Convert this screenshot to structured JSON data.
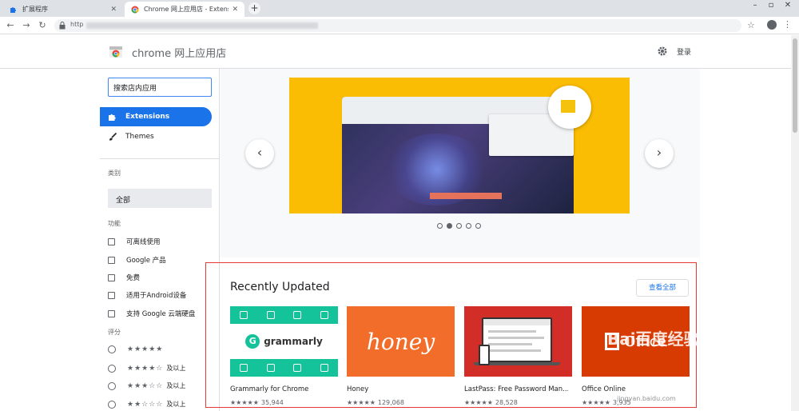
{
  "browser": {
    "tabs": [
      {
        "label": "扩展程序",
        "active": false,
        "icon": "puzzle-icon"
      },
      {
        "label": "Chrome 网上应用店 - Extensions",
        "active": true,
        "icon": "chrome-store-icon"
      }
    ],
    "url_prefix": "http",
    "accent": "#1a73e8"
  },
  "store": {
    "title": "chrome 网上应用店",
    "login": "登录"
  },
  "sidebar": {
    "search_placeholder": "搜索店内应用",
    "nav": [
      {
        "label": "Extensions",
        "selected": true
      },
      {
        "label": "Themes",
        "selected": false
      }
    ],
    "category_label": "类别",
    "category_value": "全部",
    "features_label": "功能",
    "features": [
      "可离线使用",
      "Google 产品",
      "免费",
      "适用于Android设备",
      "支持 Google 云端硬盘"
    ],
    "rating_label": "评分",
    "ratings": [
      {
        "stars": 5,
        "suffix": ""
      },
      {
        "stars": 4,
        "suffix": "及以上"
      },
      {
        "stars": 3,
        "suffix": "及以上"
      },
      {
        "stars": 2,
        "suffix": "及以上"
      }
    ]
  },
  "carousel": {
    "slides": 5,
    "current": 2
  },
  "recent": {
    "title": "Recently Updated",
    "view_all": "查看全部",
    "items": [
      {
        "name": "Grammarly for Chrome",
        "rating_count": "35,944",
        "stars": 4.5,
        "tile": "grammarly",
        "tile_text": "grammarly"
      },
      {
        "name": "Honey",
        "rating_count": "129,068",
        "stars": 5,
        "tile": "honey",
        "tile_text": "honey"
      },
      {
        "name": "LastPass: Free Password Man...",
        "rating_count": "28,528",
        "stars": 4.5,
        "tile": "lastpass",
        "tile_text": ""
      },
      {
        "name": "Office Online",
        "rating_count": "3,935",
        "stars": 4.5,
        "tile": "office",
        "tile_text": "Office"
      }
    ]
  },
  "watermark": {
    "text": "Bai百度经验",
    "sub": "jingyan.baidu.com"
  }
}
